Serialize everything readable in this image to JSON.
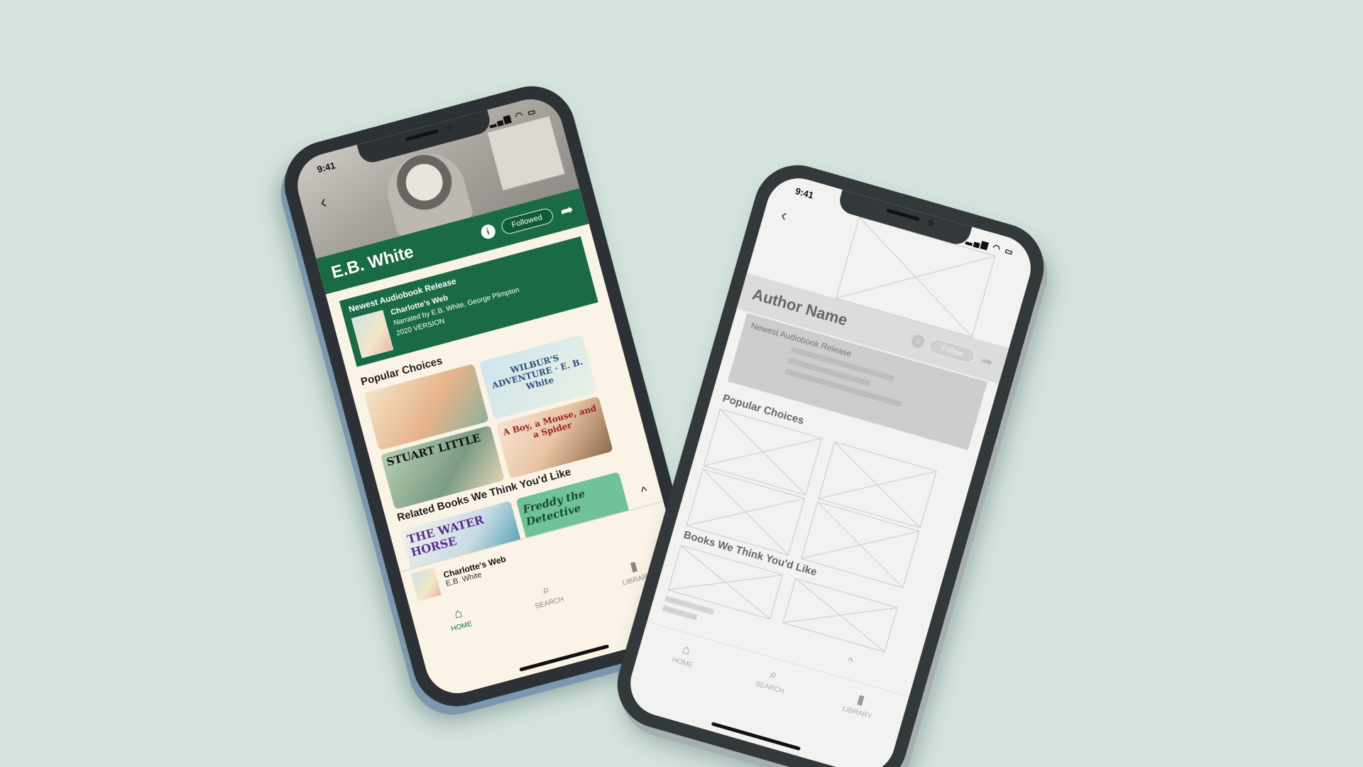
{
  "design": {
    "status": {
      "time": "9:41",
      "icons": "▂▄▆ ◠ ▭"
    },
    "back_icon": "‹",
    "author": {
      "name": "E.B. White",
      "info_icon": "i",
      "follow_label": "Followed",
      "share_icon": "➦"
    },
    "newest": {
      "heading": "Newest Audiobook Release",
      "title": "Charlotte's Web",
      "narrated": "Narrated by E.B. White, George Plimpton",
      "version": "2020 VERSION"
    },
    "popular_title": "Popular Choices",
    "popular_books": [
      {
        "label": ""
      },
      {
        "label": "WILBUR'S ADVENTURE · E. B. White"
      },
      {
        "label": "STUART LITTLE"
      },
      {
        "label": "A Boy, a Mouse, and a Spider"
      }
    ],
    "related_title": "Related Books We Think You'd Like",
    "related_books": [
      {
        "label": "THE WATER HORSE"
      },
      {
        "label": "Freddy the Detective"
      }
    ],
    "chevron_up": "^",
    "mini_player": {
      "title": "Charlotte's Web",
      "author": "E.B. White"
    },
    "tabs": [
      {
        "icon": "⌂",
        "label": "HOME"
      },
      {
        "icon": "⌕",
        "label": "SEARCH"
      },
      {
        "icon": "▮",
        "label": "LIBRARY"
      }
    ],
    "colors": {
      "accent": "#1a6b45",
      "background": "#fbf4e6"
    }
  },
  "wireframe": {
    "status": {
      "time": "9:41",
      "icons": "▂▄▆ ◠ ▭"
    },
    "back_icon": "‹",
    "author": {
      "name": "Author Name",
      "info_icon": "i",
      "follow_label": "Follow",
      "share_icon": "➦"
    },
    "newest_heading": "Newest Audiobook Release",
    "popular_title": "Popular Choices",
    "related_title": "Books We Think You'd Like",
    "chevron_up": "^",
    "tabs": [
      {
        "icon": "⌂",
        "label": "HOME"
      },
      {
        "icon": "⌕",
        "label": "SEARCH"
      },
      {
        "icon": "▮",
        "label": "LIBRARY"
      }
    ]
  },
  "page": {
    "background": "#d3e4dd"
  }
}
